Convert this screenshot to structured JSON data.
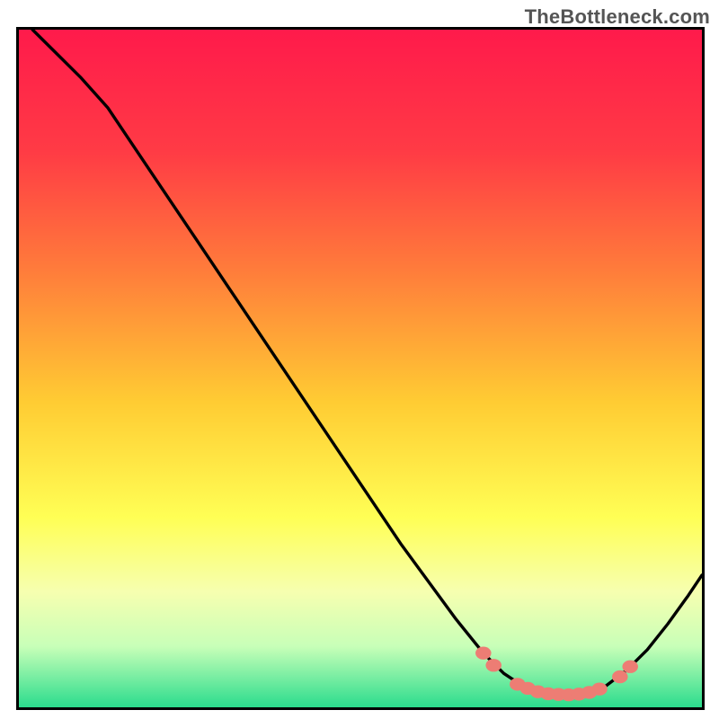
{
  "watermark": "TheBottleneck.com",
  "colors": {
    "gradient_top": "#ff1a4b",
    "gradient_mid_upper": "#ff6a3c",
    "gradient_mid": "#ffcc33",
    "gradient_mid_lower": "#ffff66",
    "gradient_lower": "#e9ffb3",
    "gradient_bottom": "#2bdc8d",
    "curve": "#000000",
    "marker": "#ed7d74",
    "border": "#000000"
  },
  "chart_data": {
    "type": "line",
    "title": "",
    "xlabel": "",
    "ylabel": "",
    "xlim": [
      0,
      100
    ],
    "ylim": [
      0,
      100
    ],
    "grid": false,
    "curve": [
      {
        "x": 2,
        "y": 100
      },
      {
        "x": 5,
        "y": 97
      },
      {
        "x": 9,
        "y": 93
      },
      {
        "x": 13,
        "y": 88.5
      },
      {
        "x": 16,
        "y": 84
      },
      {
        "x": 20,
        "y": 78
      },
      {
        "x": 26,
        "y": 69
      },
      {
        "x": 32,
        "y": 60
      },
      {
        "x": 38,
        "y": 51
      },
      {
        "x": 44,
        "y": 42
      },
      {
        "x": 50,
        "y": 33
      },
      {
        "x": 56,
        "y": 24
      },
      {
        "x": 60,
        "y": 18.5
      },
      {
        "x": 64,
        "y": 13
      },
      {
        "x": 68,
        "y": 8
      },
      {
        "x": 71,
        "y": 5
      },
      {
        "x": 74,
        "y": 3
      },
      {
        "x": 77,
        "y": 2
      },
      {
        "x": 80,
        "y": 1.8
      },
      {
        "x": 83,
        "y": 2
      },
      {
        "x": 86,
        "y": 3.2
      },
      {
        "x": 89,
        "y": 5.5
      },
      {
        "x": 92,
        "y": 8.5
      },
      {
        "x": 95,
        "y": 12.3
      },
      {
        "x": 98,
        "y": 16.5
      },
      {
        "x": 100,
        "y": 19.5
      }
    ],
    "markers": [
      {
        "x": 68,
        "y": 8
      },
      {
        "x": 69.5,
        "y": 6.2
      },
      {
        "x": 73,
        "y": 3.4
      },
      {
        "x": 74.5,
        "y": 2.8
      },
      {
        "x": 76,
        "y": 2.3
      },
      {
        "x": 77.5,
        "y": 2.0
      },
      {
        "x": 79,
        "y": 1.9
      },
      {
        "x": 80.5,
        "y": 1.85
      },
      {
        "x": 82,
        "y": 1.95
      },
      {
        "x": 83.5,
        "y": 2.2
      },
      {
        "x": 85,
        "y": 2.7
      },
      {
        "x": 88,
        "y": 4.5
      },
      {
        "x": 89.5,
        "y": 6
      }
    ],
    "gradient_stops": [
      {
        "offset": 0,
        "color": "#ff1a4b"
      },
      {
        "offset": 18,
        "color": "#ff3b45"
      },
      {
        "offset": 35,
        "color": "#ff7a3b"
      },
      {
        "offset": 55,
        "color": "#ffcc33"
      },
      {
        "offset": 72,
        "color": "#ffff55"
      },
      {
        "offset": 83,
        "color": "#f6ffb0"
      },
      {
        "offset": 91,
        "color": "#c8ffb8"
      },
      {
        "offset": 100,
        "color": "#2bdc8d"
      }
    ]
  }
}
